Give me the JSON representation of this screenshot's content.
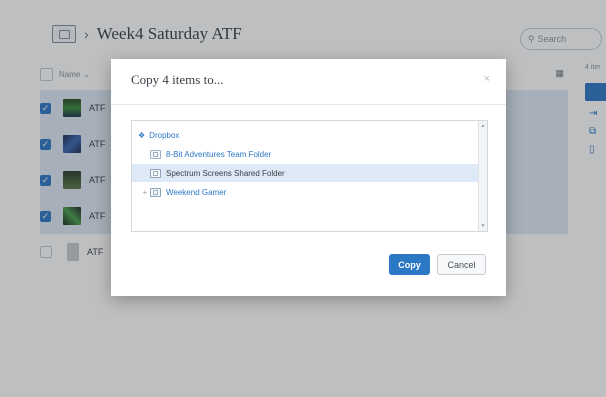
{
  "header": {
    "breadcrumb_separator": "›",
    "folder_title": "Week4 Saturday ATF",
    "search_placeholder": "Search"
  },
  "file_list": {
    "column_name": "Name",
    "sort_arrow": "⌄",
    "rows": [
      {
        "label": "ATF",
        "selected": true
      },
      {
        "label": "ATF",
        "selected": true
      },
      {
        "label": "ATF",
        "selected": true
      },
      {
        "label": "ATF",
        "selected": true
      },
      {
        "label": "ATF",
        "selected": false
      }
    ]
  },
  "right_panel": {
    "label": "4 iter"
  },
  "dialog": {
    "title": "Copy 4 items to...",
    "close_glyph": "×",
    "tree": [
      {
        "label": "Dropbox",
        "icon": "dropbox-icon",
        "expand": ""
      },
      {
        "label": "8-Bit Adventures Team Folder",
        "icon": "team-folder-icon",
        "expand": ""
      },
      {
        "label": "Spectrum Screens Shared Folder",
        "icon": "shared-folder-icon",
        "expand": ""
      },
      {
        "label": "Weekend Gamer",
        "icon": "shared-folder-icon",
        "expand": "+"
      }
    ],
    "copy_label": "Copy",
    "cancel_label": "Cancel"
  },
  "colors": {
    "accent": "#2b78c4",
    "selection": "#dde9f6"
  }
}
